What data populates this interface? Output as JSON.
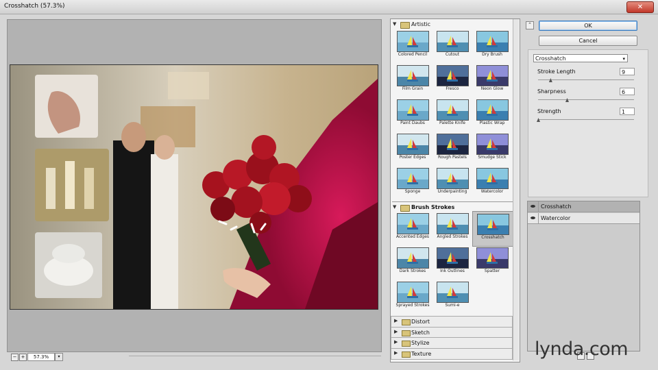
{
  "window": {
    "title": "Crosshatch (57.3%)",
    "close_symbol": "✕"
  },
  "preview": {
    "zoom_level": "57.3%",
    "zoom_out_symbol": "−",
    "zoom_in_symbol": "+",
    "dropdown_symbol": "▾"
  },
  "gallery": {
    "artistic": {
      "label": "Artistic",
      "filters": [
        "Colored Pencil",
        "Cutout",
        "Dry Brush",
        "Film Grain",
        "Fresco",
        "Neon Glow",
        "Paint Daubs",
        "Palette Knife",
        "Plastic Wrap",
        "Poster Edges",
        "Rough Pastels",
        "Smudge Stick",
        "Sponge",
        "Underpainting",
        "Watercolor"
      ]
    },
    "brush_strokes": {
      "label": "Brush Strokes",
      "filters": [
        "Accented Edges",
        "Angled Strokes",
        "Crosshatch",
        "Dark Strokes",
        "Ink Outlines",
        "Spatter",
        "Sprayed Strokes",
        "Sumi-e"
      ],
      "selected": "Crosshatch"
    },
    "collapsed_categories": [
      "Distort",
      "Sketch",
      "Stylize",
      "Texture"
    ],
    "expanded_symbol": "▼",
    "collapsed_symbol": "▶"
  },
  "controls": {
    "collapse_symbol": "⌃",
    "ok_label": "OK",
    "cancel_label": "Cancel",
    "filter_select": "Crosshatch",
    "filter_select_arrow": "▾",
    "params": [
      {
        "label": "Stroke Length",
        "value": "9",
        "min": 3,
        "max": 50
      },
      {
        "label": "Sharpness",
        "value": "6",
        "min": 0,
        "max": 20
      },
      {
        "label": "Strength",
        "value": "1",
        "min": 1,
        "max": 3
      }
    ]
  },
  "layers": [
    {
      "name": "Crosshatch",
      "active": true
    },
    {
      "name": "Watercolor",
      "active": false
    }
  ],
  "watermark": {
    "brand": "lynda.com"
  },
  "icons": {
    "close": "close-icon",
    "folder": "folder-icon",
    "eye": "eye-icon",
    "new_layer": "new-layer-icon",
    "delete_layer": "delete-layer-icon"
  },
  "colors": {
    "accent": "#3b7bbd",
    "selected_layer": "#b2b2b2",
    "rose": "#a6121e",
    "dress": "#c4124e"
  }
}
